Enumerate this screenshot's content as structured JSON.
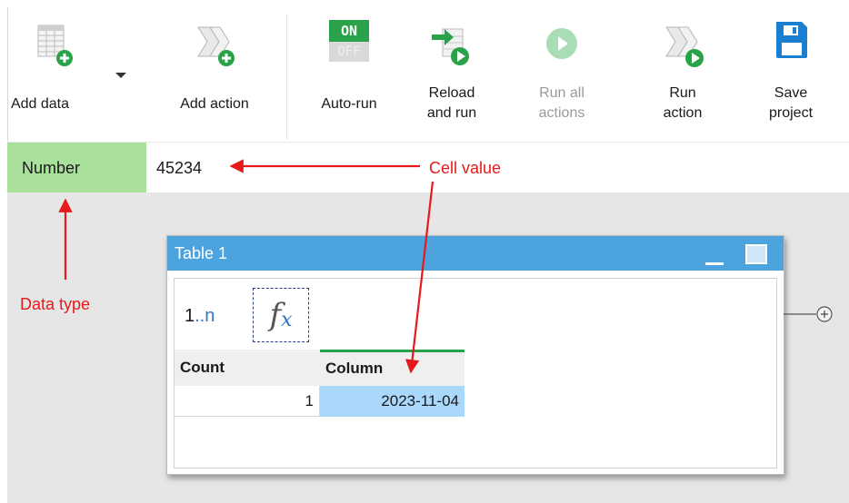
{
  "toolbar": {
    "buttons": [
      {
        "id": "add-data",
        "label": "Add data",
        "icon": "add-data-icon"
      },
      {
        "id": "add-action",
        "label": "Add action",
        "icon": "add-action-icon"
      },
      {
        "id": "auto-run",
        "label": "Auto-run",
        "icon": "toggle-on-off-icon",
        "on_text": "ON",
        "off_text": "OFF"
      },
      {
        "id": "reload-run",
        "label": "Reload\nand run",
        "icon": "reload-and-run-icon"
      },
      {
        "id": "run-all",
        "label": "Run all\nactions",
        "icon": "play-icon",
        "disabled": true
      },
      {
        "id": "run-action",
        "label": "Run\naction",
        "icon": "run-action-icon"
      },
      {
        "id": "save-project",
        "label": "Save\nproject",
        "icon": "floppy-disk-icon"
      }
    ],
    "colors": {
      "green": "#2aa24a",
      "blue": "#1a7fd1"
    }
  },
  "cell": {
    "type": "Number",
    "value": "45234"
  },
  "table_window": {
    "title": "Table 1",
    "row_count_prefix": "1",
    "row_count_dots": "..",
    "row_count_suffix": "n",
    "fx_label": "f",
    "fx_sub": "x",
    "columns": [
      "Count",
      "Column"
    ],
    "rows": [
      {
        "count": "1",
        "column": "2023-11-04"
      }
    ]
  },
  "annotations": {
    "cell_value": "Cell value",
    "data_type": "Data type",
    "color": "#e61a1a"
  }
}
